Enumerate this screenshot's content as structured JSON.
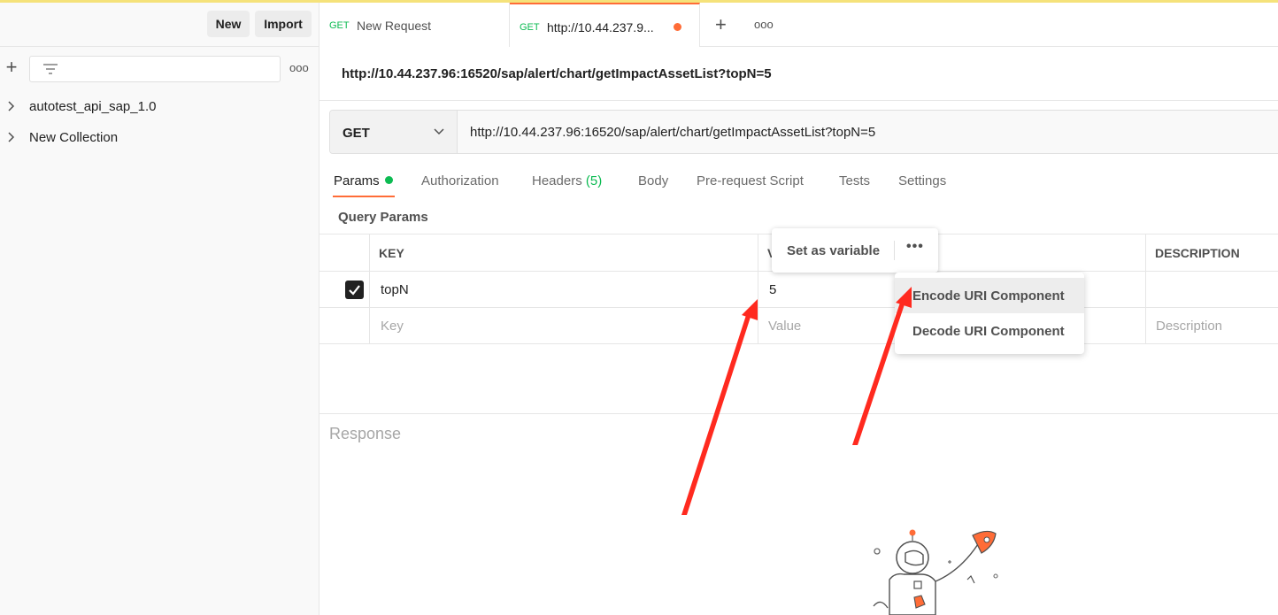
{
  "sidebar": {
    "new_label": "New",
    "import_label": "Import",
    "collections": [
      {
        "label": "autotest_api_sap_1.0"
      },
      {
        "label": "New Collection"
      }
    ]
  },
  "tabs": [
    {
      "method": "GET",
      "label": "New Request"
    },
    {
      "method": "GET",
      "label": "http://10.44.237.9..."
    }
  ],
  "request": {
    "title": "http://10.44.237.96:16520/sap/alert/chart/getImpactAssetList?topN=5",
    "method": "GET",
    "url": "http://10.44.237.96:16520/sap/alert/chart/getImpactAssetList?topN=5"
  },
  "subtabs": {
    "params": "Params",
    "authorization": "Authorization",
    "headers": "Headers",
    "headers_count": "(5)",
    "body": "Body",
    "prerequest": "Pre-request Script",
    "tests": "Tests",
    "settings": "Settings"
  },
  "query_params": {
    "label": "Query Params",
    "columns": {
      "key": "KEY",
      "value": "V",
      "description": "DESCRIPTION"
    },
    "rows": [
      {
        "key": "topN",
        "value": "5",
        "description": "",
        "checked": true
      }
    ],
    "placeholders": {
      "key": "Key",
      "value": "Value",
      "description": "Description"
    }
  },
  "popover": {
    "set_variable": "Set as variable",
    "more": "•••"
  },
  "menu": {
    "items": [
      "Encode URI Component",
      "Decode URI Component"
    ]
  },
  "response": {
    "label": "Response"
  },
  "colors": {
    "accent": "#ff6c37",
    "get_method": "#0cbb52",
    "annotation_arrow": "#ff2a1f"
  }
}
